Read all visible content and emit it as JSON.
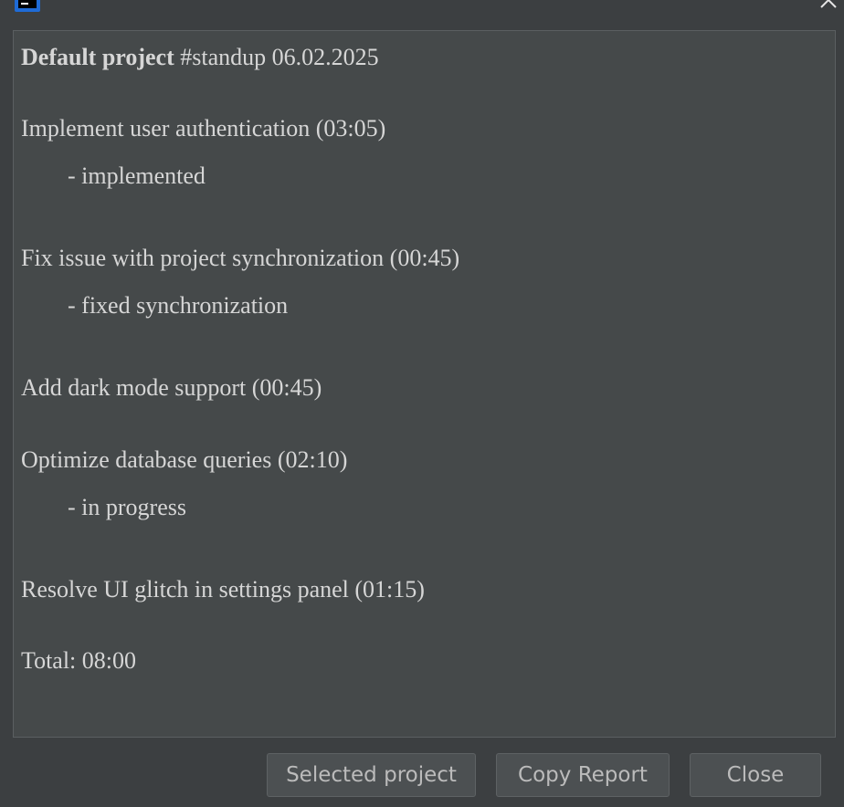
{
  "report": {
    "header_project": "Default project",
    "header_rest": " #standup 06.02.2025",
    "lines": [
      "Implement user authentication (03:05)",
      "- implemented",
      "Fix issue with project synchronization (00:45)",
      "- fixed synchronization",
      "Add dark mode support (00:45)",
      "Optimize database queries (02:10)",
      "- in progress",
      "Resolve UI glitch in settings panel (01:15)",
      "Total: 08:00"
    ]
  },
  "buttons": {
    "selected_project": "Selected project",
    "copy_report": "Copy Report",
    "close": "Close"
  },
  "icons": {
    "app": "app-icon",
    "close": "close-icon"
  },
  "colors": {
    "window_bg": "#3c3f41",
    "panel_bg": "#45494a",
    "text": "#d6d6d6",
    "button_bg": "#4c5052",
    "accent": "#1f6bd6"
  }
}
